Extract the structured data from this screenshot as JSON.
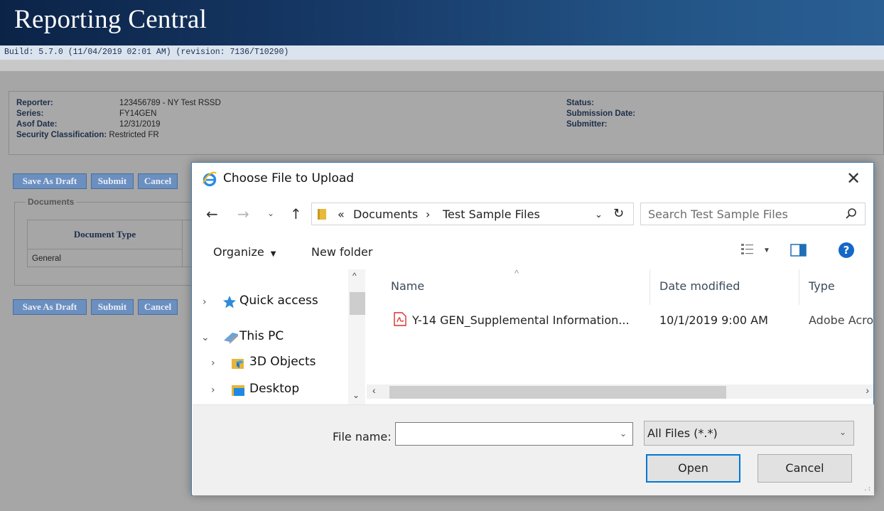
{
  "app": {
    "title": "Reporting Central",
    "build": "Build: 5.7.0 (11/04/2019 02:01 AM) (revision: 7136/T10290)"
  },
  "info": {
    "reporter_label": "Reporter:",
    "reporter_value": "123456789 - NY Test RSSD",
    "series_label": "Series:",
    "series_value": "FY14GEN",
    "asof_label": "Asof Date:",
    "asof_value": "12/31/2019",
    "security_label": "Security Classification:",
    "security_value": "Restricted FR",
    "status_label": "Status:",
    "submission_label": "Submission Date:",
    "submitter_label": "Submitter:"
  },
  "buttons": {
    "save_draft": "Save As Draft",
    "submit": "Submit",
    "cancel": "Cancel"
  },
  "documents": {
    "legend": "Documents",
    "header": "Document Type",
    "rows": [
      "General"
    ]
  },
  "dialog": {
    "title": "Choose File to Upload",
    "breadcrumb_prefix": "«",
    "breadcrumb": [
      "Documents",
      "Test Sample Files"
    ],
    "search_placeholder": "Search Test Sample Files",
    "organize": "Organize",
    "new_folder": "New folder",
    "nav_items": [
      "Quick access",
      "This PC",
      "3D Objects",
      "Desktop"
    ],
    "columns": [
      "Name",
      "Date modified",
      "Type"
    ],
    "files": [
      {
        "name": "Y-14 GEN_Supplemental Information...",
        "date": "10/1/2019 9:00 AM",
        "type": "Adobe Acro"
      }
    ],
    "file_name_label": "File name:",
    "file_name_value": "",
    "filter": "All Files (*.*)",
    "open": "Open",
    "cancel": "Cancel"
  },
  "colors": {
    "header_dark": "#0b2347",
    "header_light": "#2a5f94",
    "app_button": "#6b8fbf",
    "dialog_accent": "#0078d7"
  }
}
